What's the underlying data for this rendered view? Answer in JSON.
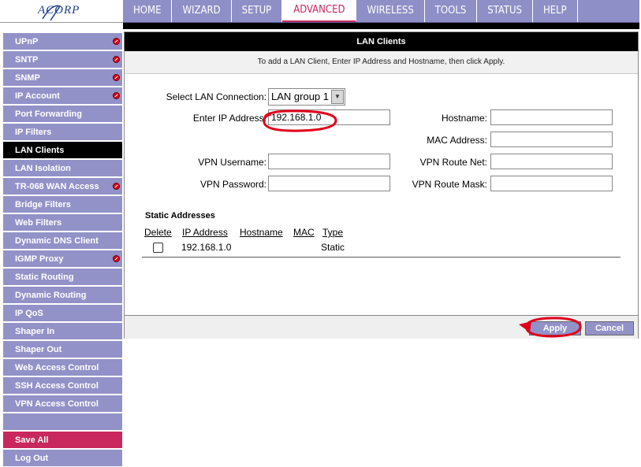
{
  "brand": {
    "logo_text": "ACORP"
  },
  "topnav": {
    "tabs": [
      {
        "label": "HOME"
      },
      {
        "label": "WIZARD"
      },
      {
        "label": "SETUP"
      },
      {
        "label": "ADVANCED",
        "active": true
      },
      {
        "label": "WIRELESS"
      },
      {
        "label": "TOOLS"
      },
      {
        "label": "STATUS"
      },
      {
        "label": "HELP"
      }
    ]
  },
  "sidebar": {
    "items": [
      {
        "label": "UPnP",
        "alert": true
      },
      {
        "label": "SNTP",
        "alert": true
      },
      {
        "label": "SNMP",
        "alert": true
      },
      {
        "label": "IP Account",
        "alert": true
      },
      {
        "label": "Port Forwarding"
      },
      {
        "label": "IP Filters"
      },
      {
        "label": "LAN Clients",
        "active": true
      },
      {
        "label": "LAN Isolation"
      },
      {
        "label": "TR-068 WAN Access",
        "alert": true
      },
      {
        "label": "Bridge Filters"
      },
      {
        "label": "Web Filters"
      },
      {
        "label": "Dynamic DNS Client"
      },
      {
        "label": "IGMP Proxy",
        "alert": true
      },
      {
        "label": "Static Routing"
      },
      {
        "label": "Dynamic Routing"
      },
      {
        "label": "IP QoS"
      },
      {
        "label": "Shaper In"
      },
      {
        "label": "Shaper Out"
      },
      {
        "label": "Web Access Control"
      },
      {
        "label": "SSH Access Control"
      },
      {
        "label": "VPN Access Control"
      }
    ],
    "save_all": "Save All",
    "log_out": "Log Out"
  },
  "panel": {
    "title": "LAN Clients",
    "description": "To add a LAN Client, Enter IP Address and Hostname, then click Apply.",
    "form": {
      "select_lan_label": "Select LAN Connection:",
      "select_lan_value": "LAN group 1",
      "ip_label": "Enter IP Address:",
      "ip_value": "192.168.1.0",
      "hostname_label": "Hostname:",
      "hostname_value": "",
      "mac_label": "MAC Address:",
      "mac_value": "",
      "vpn_user_label": "VPN Username:",
      "vpn_user_value": "",
      "vpn_pass_label": "VPN Password:",
      "vpn_pass_value": "",
      "vpn_route_net_label": "VPN Route Net:",
      "vpn_route_net_value": "",
      "vpn_route_mask_label": "VPN Route Mask:",
      "vpn_route_mask_value": ""
    },
    "static": {
      "title": "Static Addresses",
      "headers": [
        "Delete",
        "IP Address",
        "Hostname",
        "MAC",
        "Type"
      ],
      "rows": [
        {
          "ip": "192.168.1.0",
          "hostname": "",
          "mac": "",
          "type": "Static"
        }
      ]
    },
    "buttons": {
      "apply": "Apply",
      "cancel": "Cancel"
    }
  },
  "colors": {
    "nav": "#8e8fc6",
    "sidebar": "#9292c8",
    "accent": "#c8285d",
    "annotation": "#e0001b"
  }
}
